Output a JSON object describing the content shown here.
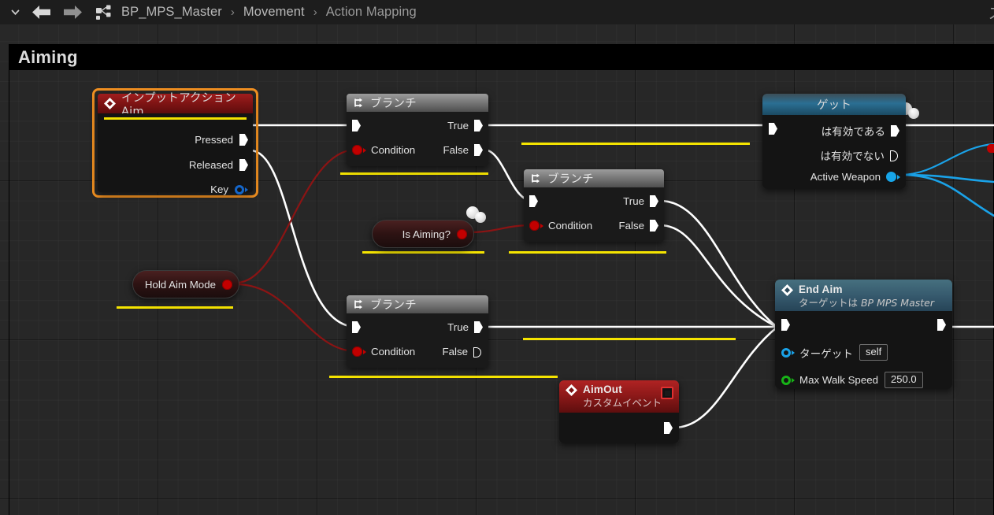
{
  "topbar": {
    "dropdown_icon": "chevron-down-icon",
    "back_icon": "back-arrow-icon",
    "forward_icon": "forward-arrow-icon",
    "graph_icon": "blueprint-graph-icon",
    "breadcrumb": [
      {
        "label": "BP_MPS_Master"
      },
      {
        "label": "Movement"
      },
      {
        "label": "Action Mapping"
      }
    ],
    "separator": "›",
    "right_partial_text": "ズ"
  },
  "comment": {
    "title": "Aiming"
  },
  "nodes": {
    "input_action": {
      "title": "インプットアクション Aim",
      "icon": "event-diamond-icon",
      "selected": true,
      "pins": [
        {
          "label": "Pressed",
          "type": "exec"
        },
        {
          "label": "Released",
          "type": "exec"
        },
        {
          "label": "Key",
          "type": "struct"
        }
      ]
    },
    "branch1": {
      "title": "ブランチ",
      "icon": "branch-icon",
      "in_exec": "",
      "in_condition": "Condition",
      "out_true": "True",
      "out_false": "False"
    },
    "branch2": {
      "title": "ブランチ",
      "icon": "branch-icon",
      "in_exec": "",
      "in_condition": "Condition",
      "out_true": "True",
      "out_false": "False"
    },
    "branch3": {
      "title": "ブランチ",
      "icon": "branch-icon",
      "in_exec": "",
      "in_condition": "Condition",
      "out_true": "True",
      "out_false": "False"
    },
    "is_aiming": {
      "label": "Is Aiming?",
      "pin_type": "boolean"
    },
    "hold_aim_mode": {
      "label": "Hold Aim Mode",
      "pin_type": "boolean"
    },
    "get_node": {
      "title": "ゲット",
      "pins": [
        {
          "label": "は有効である",
          "type": "exec"
        },
        {
          "label": "は有効でない",
          "type": "exec-hollow"
        },
        {
          "label": "Active Weapon",
          "type": "object"
        }
      ],
      "has_comment_bubble": true
    },
    "end_aim": {
      "title": "End Aim",
      "subtitle_prefix": "ターゲットは ",
      "subtitle_target": "BP MPS Master",
      "icon": "event-diamond-icon",
      "params": [
        {
          "label": "ターゲット",
          "value": "self",
          "pin": "object"
        },
        {
          "label": "Max Walk Speed",
          "value": "250.0",
          "pin": "float"
        }
      ]
    },
    "aim_out": {
      "title": "AimOut",
      "subtitle": "カスタムイベント",
      "icon": "event-diamond-icon",
      "delegate_pin": "delegate-square-pin"
    }
  },
  "colors": {
    "accent_selection": "#f19021",
    "exec_wire": "#ffffff",
    "bool_wire": "#8b1414",
    "object_wire": "#1aa2e8",
    "highlight_underline": "#f5e400",
    "event_header": "#8f1414",
    "function_header": "#3d6b88",
    "canvas_bg": "#282828"
  }
}
